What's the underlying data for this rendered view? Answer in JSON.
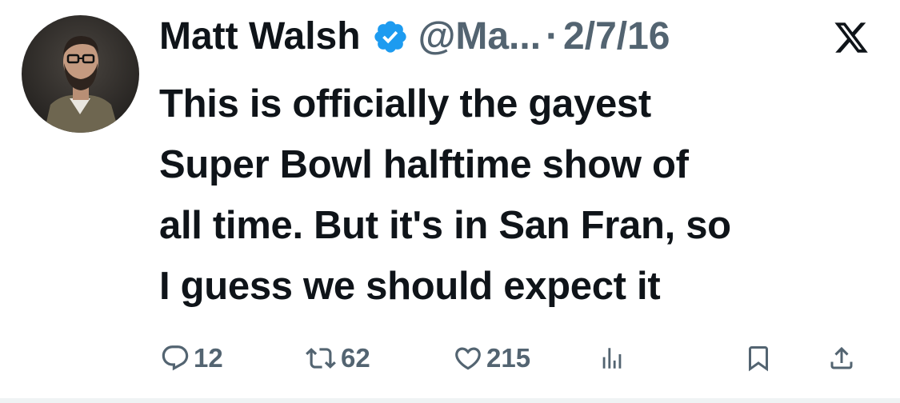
{
  "author": {
    "name": "Matt Walsh",
    "handle": "@Ma...",
    "verified": true
  },
  "separator": "·",
  "date": "2/7/16",
  "platform_icon": "x-logo-icon",
  "tweet": {
    "text": "This is officially the gayest\nSuper Bowl halftime show of\nall time. But it's in San Fran, so\nI guess we should expect it"
  },
  "actions": {
    "replies": "12",
    "reposts": "62",
    "likes": "215",
    "icons": [
      "reply-icon",
      "repost-icon",
      "like-icon",
      "views-icon",
      "bookmark-icon",
      "share-icon"
    ]
  },
  "colors": {
    "text": "#0f1419",
    "secondary": "#536471",
    "verified": "#1d9bf0",
    "background": "#ffffff"
  }
}
